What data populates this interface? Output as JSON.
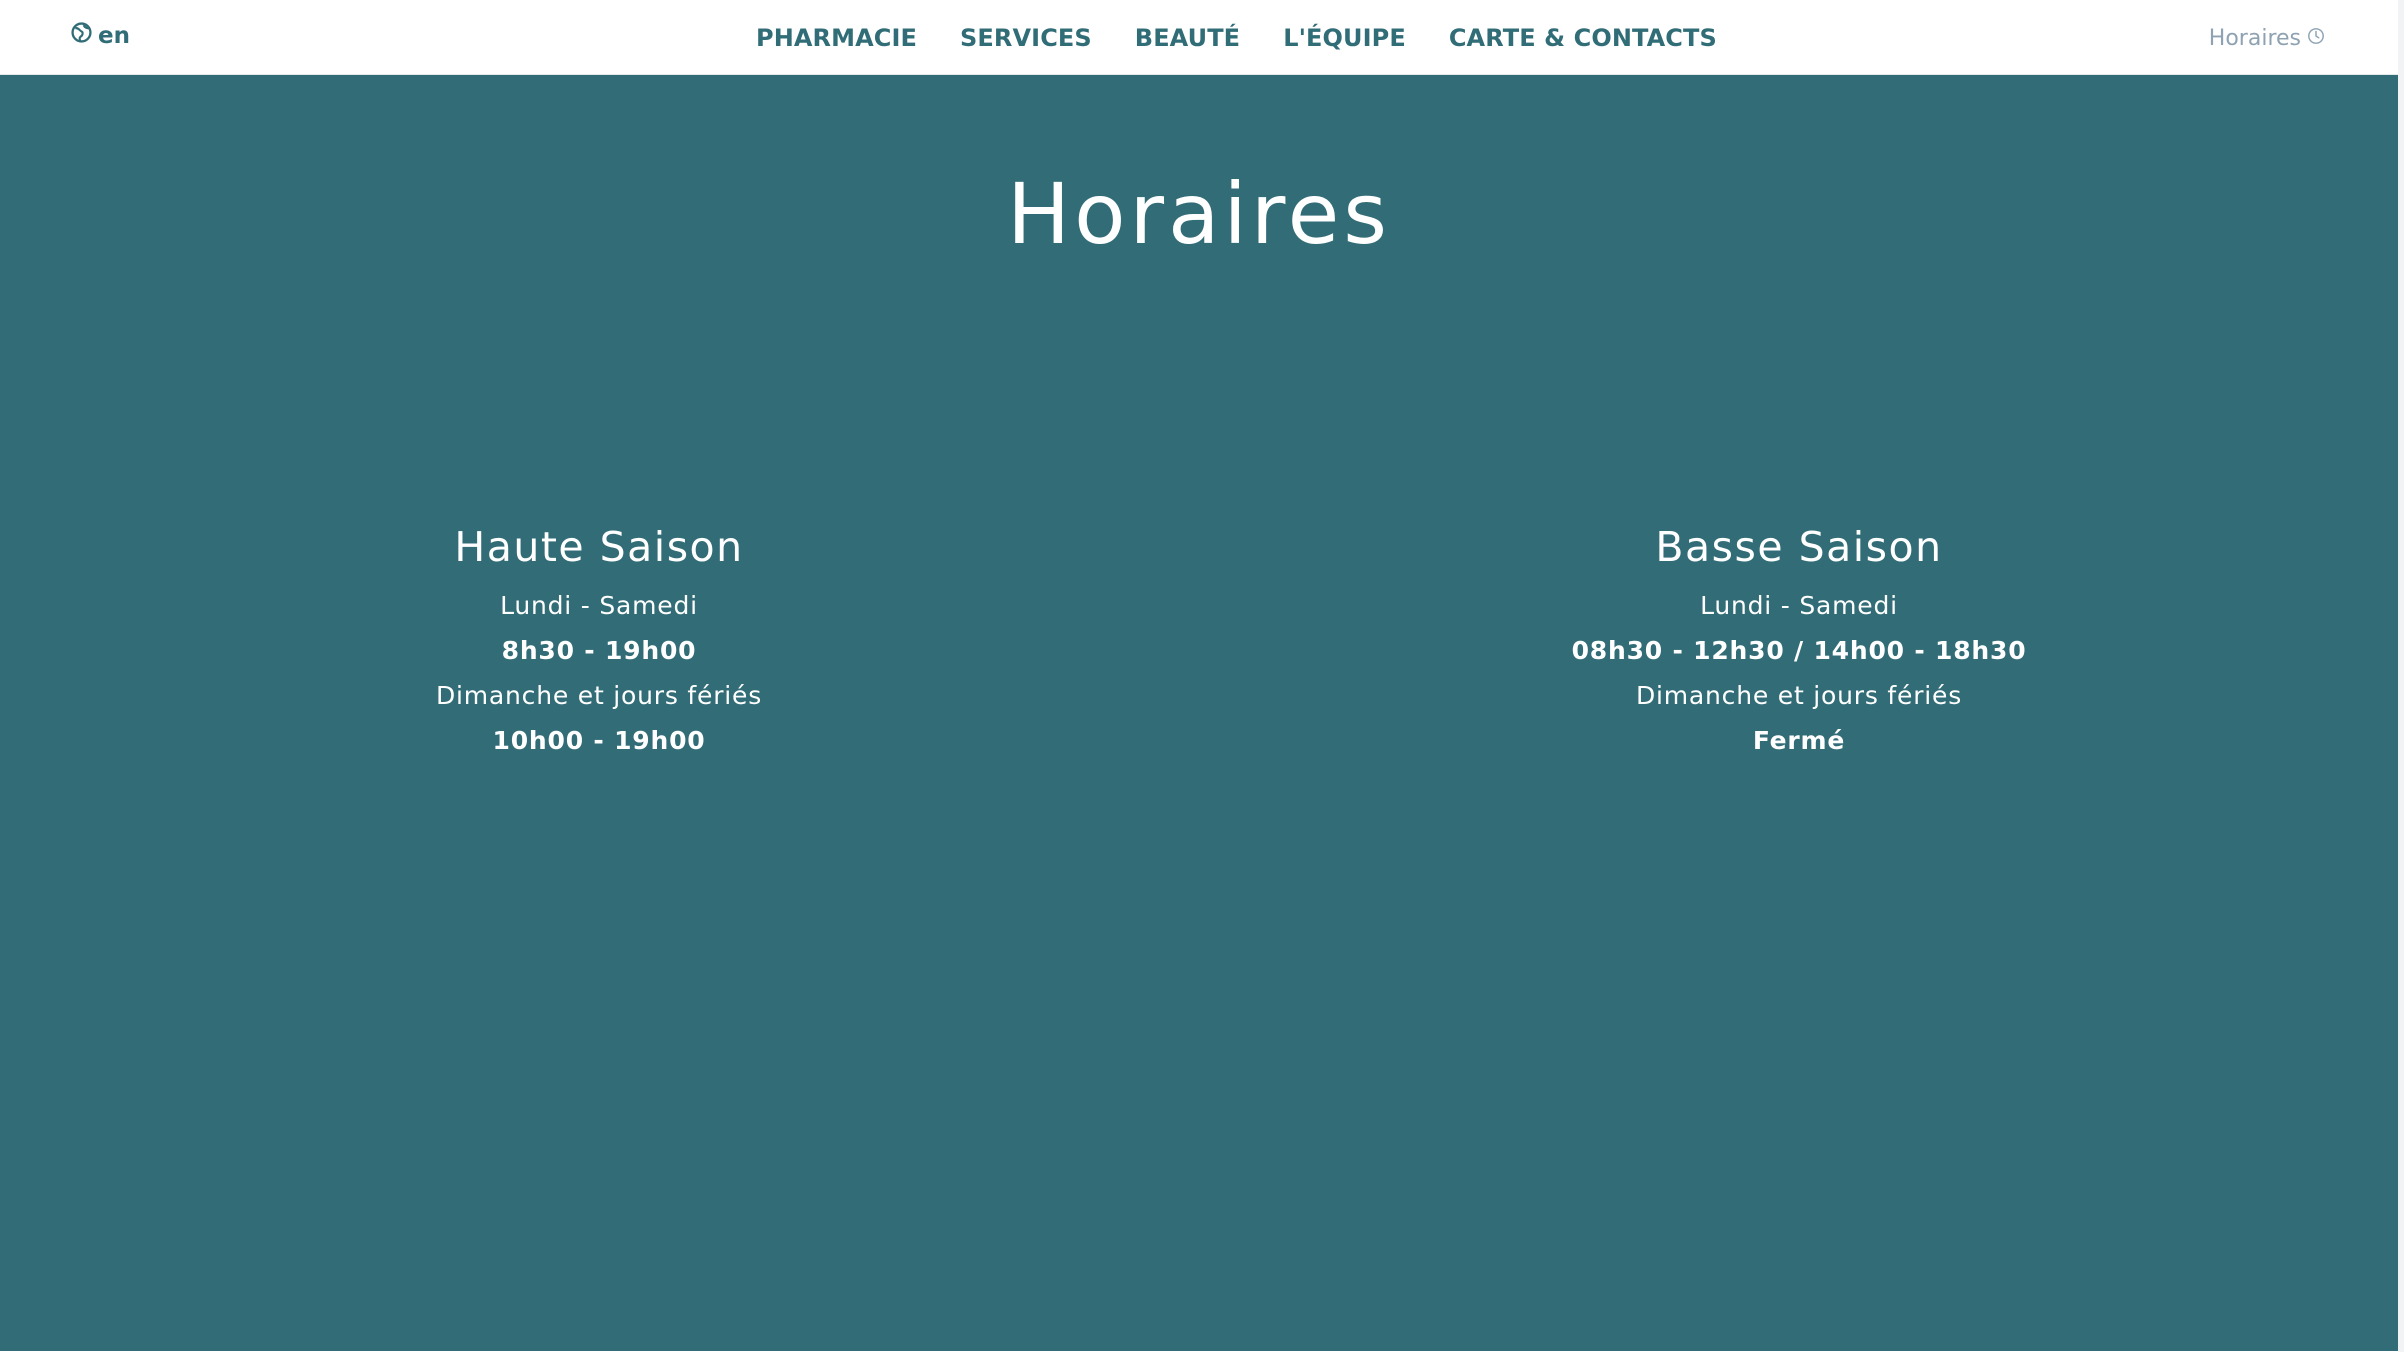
{
  "header": {
    "language": "en",
    "nav": [
      "PHARMACIE",
      "SERVICES",
      "BEAUTÉ",
      "L'ÉQUIPE",
      "CARTE & CONTACTS"
    ],
    "hours_link": "Horaires"
  },
  "main": {
    "title": "Horaires",
    "seasons": [
      {
        "name": "Haute Saison",
        "weekdays_label": "Lundi - Samedi",
        "weekdays_hours": "8h30 - 19h00",
        "sunday_label": "Dimanche et jours fériés",
        "sunday_hours": "10h00 - 19h00"
      },
      {
        "name": "Basse Saison",
        "weekdays_label": "Lundi - Samedi",
        "weekdays_hours": "08h30 - 12h30 / 14h00 - 18h30",
        "sunday_label": "Dimanche et jours fériés",
        "sunday_hours": "Fermé"
      }
    ]
  },
  "colors": {
    "brand": "#326d77",
    "muted": "#8ea2b2",
    "text_on_brand": "#ffffff"
  },
  "icons": {
    "language": "globe-icon",
    "hours": "clock-icon"
  }
}
